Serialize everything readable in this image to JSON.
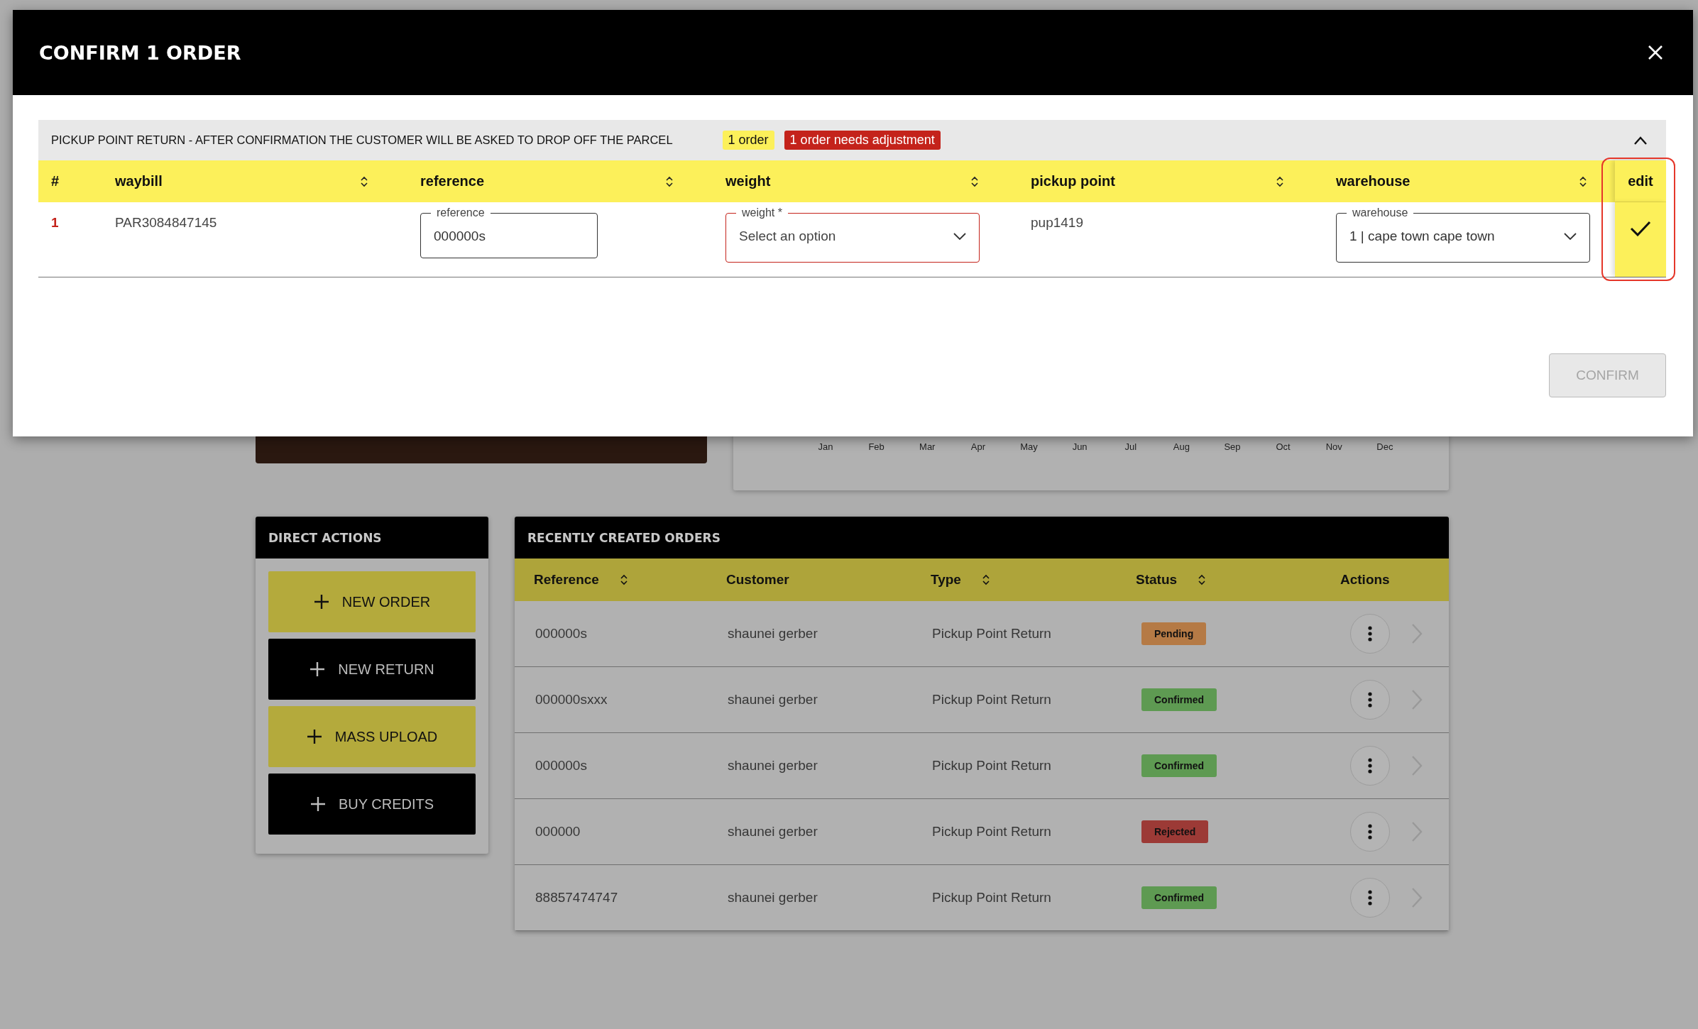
{
  "modal": {
    "title": "CONFIRM 1 ORDER",
    "section": {
      "title": "PICKUP POINT RETURN - AFTER CONFIRMATION THE CUSTOMER WILL BE ASKED TO DROP OFF THE PARCEL",
      "expanded": true,
      "badges": [
        {
          "kind": "count",
          "text": "1 order"
        },
        {
          "kind": "warning",
          "text": "1 order needs adjustment"
        }
      ],
      "columns": [
        {
          "label": "#",
          "sortable": false
        },
        {
          "label": "waybill",
          "sortable": true
        },
        {
          "label": "reference",
          "sortable": true
        },
        {
          "label": "weight",
          "sortable": true
        },
        {
          "label": "pickup point",
          "sortable": true
        },
        {
          "label": "warehouse",
          "sortable": true
        },
        {
          "label": "edit",
          "sortable": false
        }
      ],
      "rows": [
        {
          "index": "1",
          "waybill": "PAR3084847145",
          "reference": {
            "label": "reference",
            "value": "000000s"
          },
          "weight": {
            "label": "weight *",
            "placeholder": "Select an option",
            "error": true
          },
          "pickup_point": "pup1419",
          "warehouse": {
            "label": "warehouse",
            "value": "1 | cape town cape town",
            "error": false
          },
          "edit_highlighted": true
        }
      ]
    },
    "confirm_button": {
      "label": "CONFIRM",
      "disabled": true
    }
  },
  "background": {
    "chart": {
      "months": [
        "Jan",
        "Feb",
        "Mar",
        "Apr",
        "May",
        "Jun",
        "Jul",
        "Aug",
        "Sep",
        "Oct",
        "Nov",
        "Dec"
      ]
    },
    "direct_actions": {
      "title": "DIRECT ACTIONS",
      "buttons": [
        {
          "kind": "primary",
          "label": "NEW ORDER"
        },
        {
          "kind": "dark",
          "label": "NEW RETURN"
        },
        {
          "kind": "primary",
          "label": "MASS UPLOAD"
        },
        {
          "kind": "dark",
          "label": "BUY CREDITS"
        }
      ]
    },
    "recent_orders": {
      "title": "RECENTLY CREATED ORDERS",
      "columns": [
        {
          "label": "Reference",
          "sortable": true
        },
        {
          "label": "Customer",
          "sortable": false
        },
        {
          "label": "Type",
          "sortable": true
        },
        {
          "label": "Status",
          "sortable": true
        },
        {
          "label": "Actions",
          "sortable": false
        }
      ],
      "rows": [
        {
          "reference": "000000s",
          "customer": "shaunei gerber",
          "type": "Pickup Point Return",
          "status": {
            "label": "Pending",
            "color": "#b57a45"
          }
        },
        {
          "reference": "000000sxxx",
          "customer": "shaunei gerber",
          "type": "Pickup Point Return",
          "status": {
            "label": "Confirmed",
            "color": "#5e9a52"
          }
        },
        {
          "reference": "000000s",
          "customer": "shaunei gerber",
          "type": "Pickup Point Return",
          "status": {
            "label": "Confirmed",
            "color": "#5e9a52"
          }
        },
        {
          "reference": "000000",
          "customer": "shaunei gerber",
          "type": "Pickup Point Return",
          "status": {
            "label": "Rejected",
            "color": "#9c3a36"
          }
        },
        {
          "reference": "88857474747",
          "customer": "shaunei gerber",
          "type": "Pickup Point Return",
          "status": {
            "label": "Confirmed",
            "color": "#5e9a52"
          }
        }
      ]
    }
  }
}
